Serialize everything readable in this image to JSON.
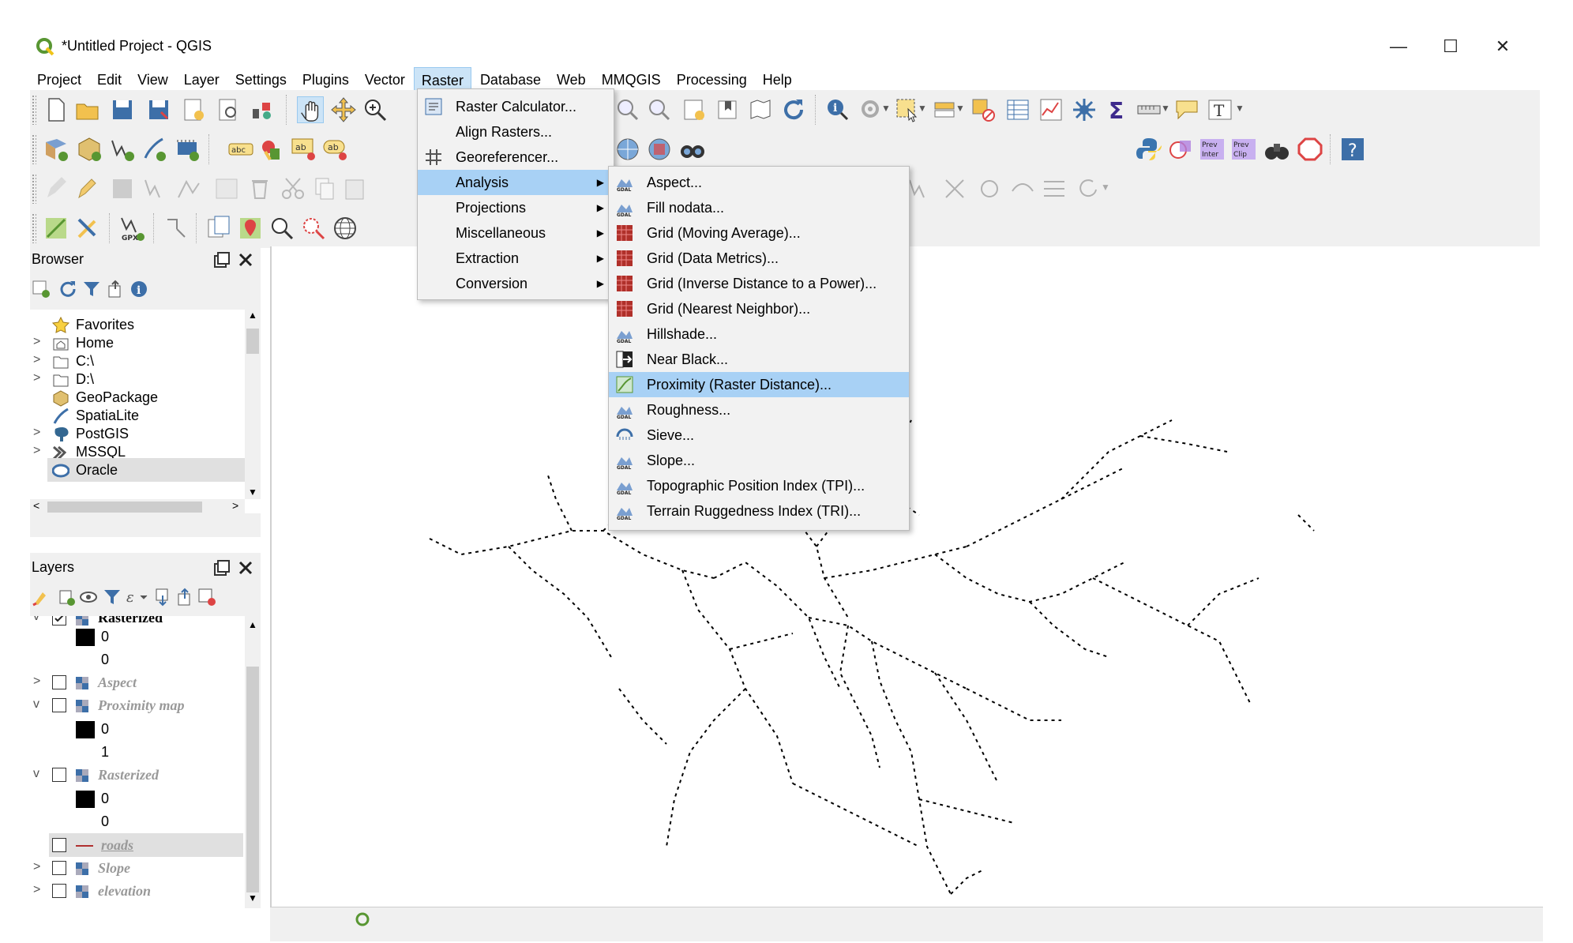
{
  "window": {
    "title": "*Untitled Project - QGIS",
    "controls": {
      "minimize": "—",
      "maximize": "☐",
      "close": "✕"
    }
  },
  "menubar": {
    "items": [
      "Project",
      "Edit",
      "View",
      "Layer",
      "Settings",
      "Plugins",
      "Vector",
      "Raster",
      "Database",
      "Web",
      "MMQGIS",
      "Processing",
      "Help"
    ],
    "open_item": "Raster"
  },
  "toolbar": {
    "gpx_label": "GPX",
    "abc_label": "abc",
    "ab_label": "ab",
    "prev_inter_label": "Prev Inter",
    "prev_clip_label": "Prev Clip",
    "help_label": "?",
    "sigma_label": "Σ",
    "text_label": "T"
  },
  "browser": {
    "title": "Browser",
    "items": [
      {
        "label": "Favorites",
        "icon": "star-icon",
        "expandable": false
      },
      {
        "label": "Home",
        "icon": "home-folder-icon",
        "expandable": true
      },
      {
        "label": "C:\\",
        "icon": "folder-icon",
        "expandable": true
      },
      {
        "label": "D:\\",
        "icon": "folder-icon",
        "expandable": true
      },
      {
        "label": "GeoPackage",
        "icon": "geopackage-icon",
        "expandable": false
      },
      {
        "label": "SpatiaLite",
        "icon": "spatialite-icon",
        "expandable": false
      },
      {
        "label": "PostGIS",
        "icon": "postgis-icon",
        "expandable": true
      },
      {
        "label": "MSSQL",
        "icon": "mssql-icon",
        "expandable": true
      },
      {
        "label": "Oracle",
        "icon": "oracle-icon",
        "expandable": false
      }
    ]
  },
  "layers": {
    "title": "Layers",
    "rows": [
      {
        "kind": "layer",
        "label": "Rasterized",
        "checked": true,
        "expanded": true,
        "style": "bold"
      },
      {
        "kind": "legend",
        "label": "0",
        "swatch": true
      },
      {
        "kind": "legend",
        "label": "0",
        "swatch": false
      },
      {
        "kind": "layer",
        "label": "Aspect",
        "checked": false,
        "expanded": false,
        "style": "dim"
      },
      {
        "kind": "layer",
        "label": "Proximity map",
        "checked": false,
        "expanded": true,
        "style": "dim"
      },
      {
        "kind": "legend",
        "label": "0",
        "swatch": true
      },
      {
        "kind": "legend",
        "label": "1",
        "swatch": false
      },
      {
        "kind": "layer",
        "label": "Rasterized",
        "checked": false,
        "expanded": true,
        "style": "dim"
      },
      {
        "kind": "legend",
        "label": "0",
        "swatch": true
      },
      {
        "kind": "legend",
        "label": "0",
        "swatch": false
      },
      {
        "kind": "vector",
        "label": "roads",
        "checked": false,
        "style": "dim"
      },
      {
        "kind": "layer",
        "label": "Slope",
        "checked": false,
        "expanded": false,
        "style": "dim"
      },
      {
        "kind": "layer",
        "label": "elevation",
        "checked": false,
        "expanded": false,
        "style": "dim"
      }
    ]
  },
  "raster_menu": {
    "items": [
      {
        "label": "Raster Calculator...",
        "submenu": false
      },
      {
        "label": "Align Rasters...",
        "submenu": false
      },
      {
        "label": "Georeferencer...",
        "submenu": false
      },
      {
        "label": "Analysis",
        "submenu": true
      },
      {
        "label": "Projections",
        "submenu": true
      },
      {
        "label": "Miscellaneous",
        "submenu": true
      },
      {
        "label": "Extraction",
        "submenu": true
      },
      {
        "label": "Conversion",
        "submenu": true
      }
    ],
    "highlighted": "Analysis"
  },
  "analysis_menu": {
    "items": [
      {
        "label": "Aspect...",
        "icon": "gdal-icon"
      },
      {
        "label": "Fill nodata...",
        "icon": "gdal-icon"
      },
      {
        "label": "Grid (Moving Average)...",
        "icon": "grid-icon"
      },
      {
        "label": "Grid (Data Metrics)...",
        "icon": "grid-icon"
      },
      {
        "label": "Grid (Inverse Distance to a Power)...",
        "icon": "grid-icon"
      },
      {
        "label": "Grid (Nearest Neighbor)...",
        "icon": "grid-icon"
      },
      {
        "label": "Hillshade...",
        "icon": "gdal-icon"
      },
      {
        "label": "Near Black...",
        "icon": "near-black-icon"
      },
      {
        "label": "Proximity (Raster Distance)...",
        "icon": "proximity-icon"
      },
      {
        "label": "Roughness...",
        "icon": "gdal-icon"
      },
      {
        "label": "Sieve...",
        "icon": "sieve-icon"
      },
      {
        "label": "Slope...",
        "icon": "gdal-icon"
      },
      {
        "label": "Topographic Position Index (TPI)...",
        "icon": "gdal-icon"
      },
      {
        "label": "Terrain Ruggedness Index (TRI)...",
        "icon": "gdal-icon"
      }
    ],
    "highlighted": "Proximity (Raster Distance)..."
  },
  "colors": {
    "menu_highlight": "#a8d1f5",
    "qgis_green": "#589632",
    "gdal_red": "#b0302a"
  }
}
